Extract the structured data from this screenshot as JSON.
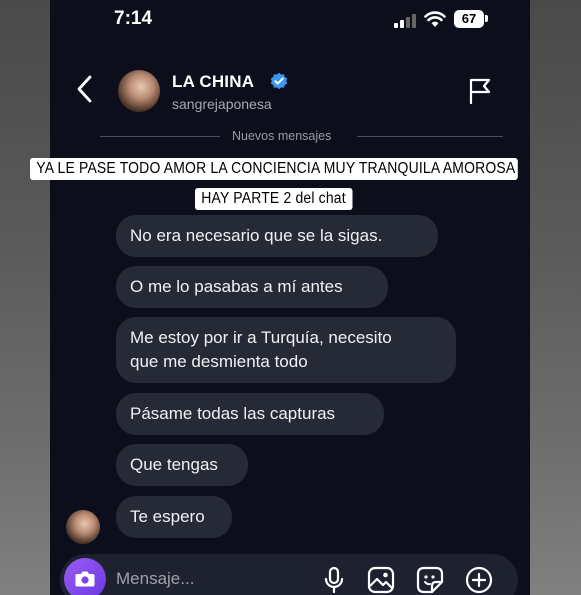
{
  "status_bar": {
    "time": "7:14",
    "battery": "67"
  },
  "header": {
    "name": "LA CHINA",
    "username": "sangrejaponesa"
  },
  "separator": {
    "label": "Nuevos mensajes"
  },
  "caption": {
    "line1": "YA LE PASE TODO AMOR LA CONCIENCIA MUY TRANQUILA AMOROSA",
    "line2": "HAY PARTE 2 del chat"
  },
  "messages": [
    {
      "text": "No era necesario que se la sigas."
    },
    {
      "text": "O me lo pasabas a mí antes"
    },
    {
      "line1": "Me estoy por ir a Turquía, necesito",
      "line2": "que me desmienta todo"
    },
    {
      "text": "Pásame todas las capturas"
    },
    {
      "text": "Que tengas"
    },
    {
      "text": "Te espero"
    }
  ],
  "composer": {
    "placeholder": "Mensaje..."
  },
  "icons": {
    "back": "chevron-left-icon",
    "verified": "verified-badge-icon",
    "report": "flag-icon",
    "camera": "camera-icon",
    "mic": "microphone-icon",
    "gallery": "image-icon",
    "sticker": "sticker-icon",
    "add": "plus-circle-icon"
  },
  "colors": {
    "background": "#0c0f1b",
    "bubble": "#262a37",
    "verified": "#3b97f0",
    "camera_gradient": "#8a4df2"
  }
}
